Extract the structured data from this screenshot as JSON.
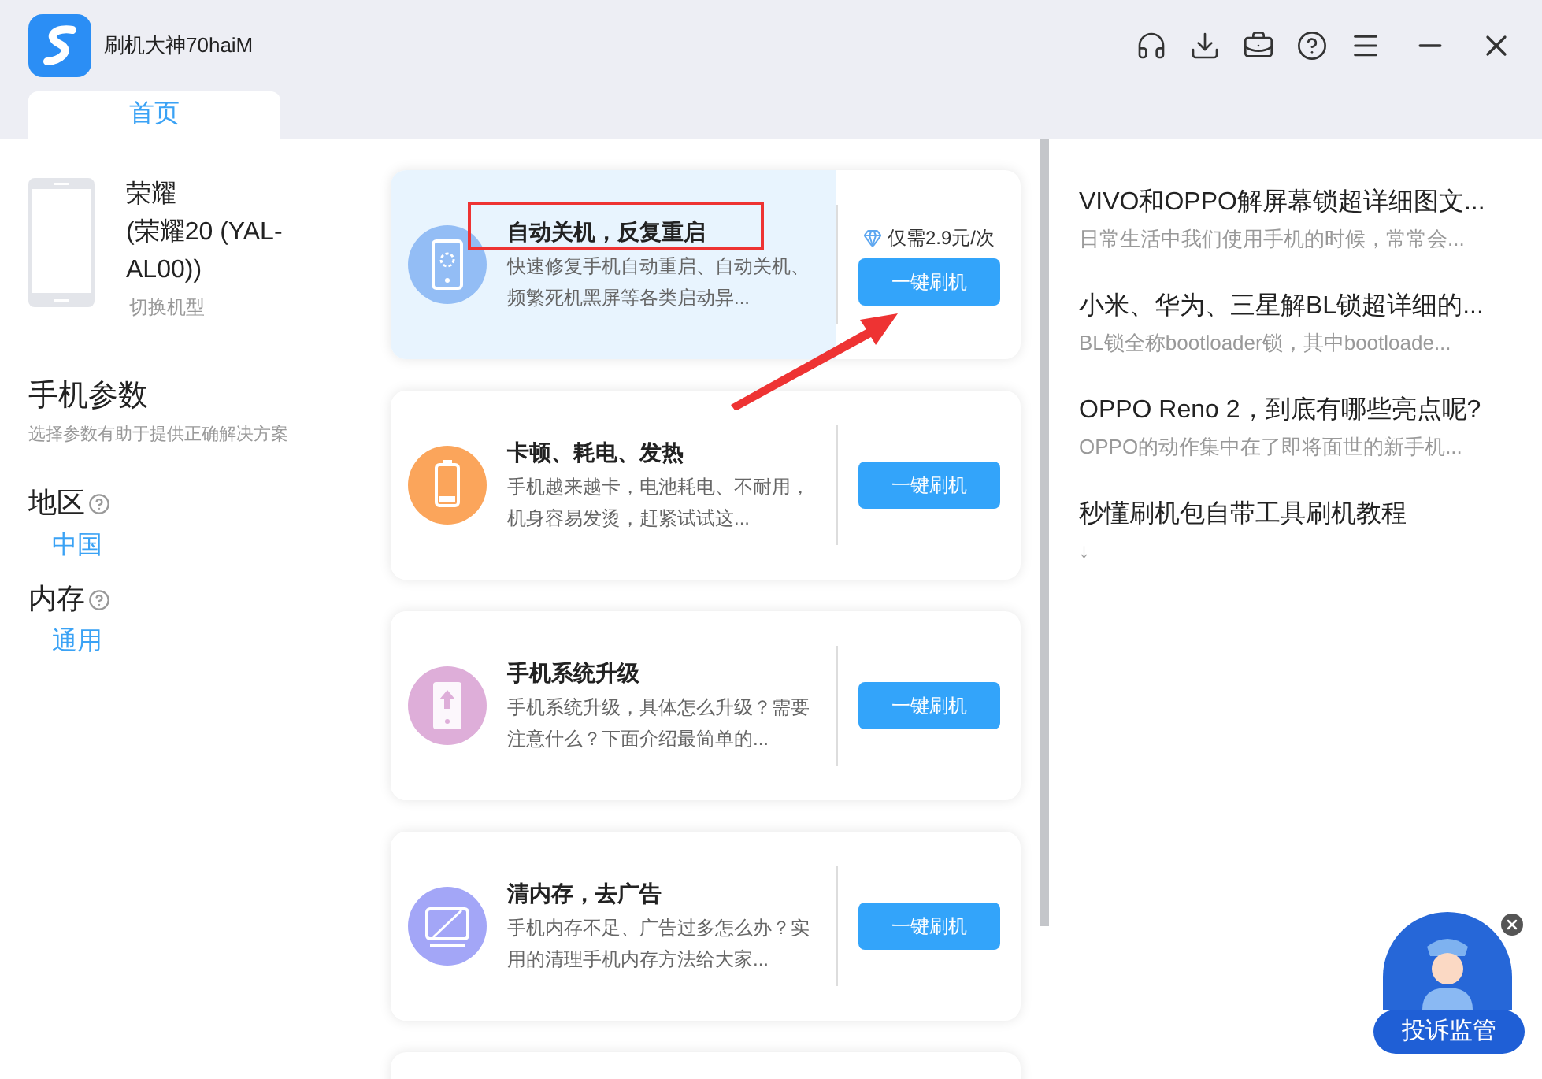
{
  "app": {
    "title": "刷机大神70haiM"
  },
  "tabs": [
    {
      "label": "首页",
      "selected": true
    }
  ],
  "device": {
    "brand": "荣耀",
    "model": "(荣耀20 (YAL-AL00))",
    "switch_link": "切换机型"
  },
  "params": {
    "title": "手机参数",
    "subtitle": "选择参数有助于提供正确解决方案",
    "fields": [
      {
        "label": "地区",
        "value": "中国"
      },
      {
        "label": "内存",
        "value": "通用"
      }
    ]
  },
  "cards": [
    {
      "kind": "phone-loading",
      "color": "#93bdf5",
      "highlighted": true,
      "title": "自动关机，反复重启",
      "desc": "快速修复手机自动重启、自动关机、频繁死机黑屏等各类启动异...",
      "price": "仅需2.9元/次",
      "button": "一键刷机"
    },
    {
      "kind": "battery",
      "color": "#fba55b",
      "highlighted": false,
      "title": "卡顿、耗电、发热",
      "desc": "手机越来越卡，电池耗电、不耐用，机身容易发烫，赶紧试试这...",
      "button": "一键刷机"
    },
    {
      "kind": "phone-upload",
      "color": "#deaed9",
      "highlighted": false,
      "title": "手机系统升级",
      "desc": "手机系统升级，具体怎么升级？需要注意什么？下面介绍最简单的...",
      "button": "一键刷机"
    },
    {
      "kind": "no-ad",
      "color": "#a3a6f7",
      "highlighted": false,
      "title": "清内存，去广告",
      "desc": "手机内存不足、广告过多怎么办？实用的清理手机内存方法给大家...",
      "button": "一键刷机"
    }
  ],
  "articles": [
    {
      "title": "VIVO和OPPO解屏幕锁超详细图文...",
      "summary": "日常生活中我们使用手机的时候，常常会..."
    },
    {
      "title": "小米、华为、三星解BL锁超详细的...",
      "summary": "BL锁全称bootloader锁，其中bootloade..."
    },
    {
      "title": "OPPO Reno 2，到底有哪些亮点呢?",
      "summary": "OPPO的动作集中在了即将面世的新手机..."
    },
    {
      "title": "秒懂刷机包自带工具刷机教程",
      "summary": "↓"
    }
  ],
  "complaint_badge": {
    "label": "投诉监管"
  }
}
